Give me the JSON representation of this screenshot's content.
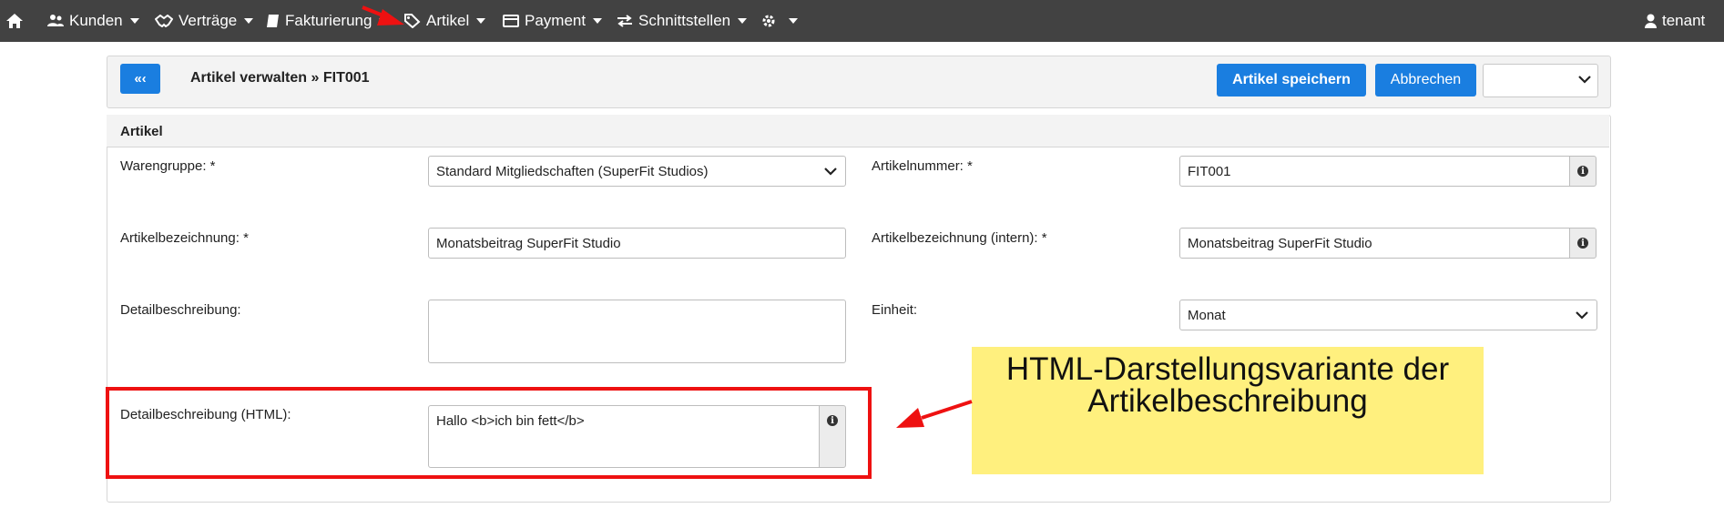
{
  "nav": {
    "items": [
      {
        "label": "Kunden"
      },
      {
        "label": "Verträge"
      },
      {
        "label": "Fakturierung"
      },
      {
        "label": "Artikel"
      },
      {
        "label": "Payment"
      },
      {
        "label": "Schnittstellen"
      }
    ],
    "user": "tenant"
  },
  "header": {
    "back_label": "«‹",
    "title": "Artikel verwalten » FIT001",
    "save_label": "Artikel speichern",
    "cancel_label": "Abbrechen",
    "select_value": ""
  },
  "panel": {
    "title": "Artikel",
    "fields": {
      "warengruppe": {
        "label": "Warengruppe: *",
        "value": "Standard Mitgliedschaften (SuperFit Studios)"
      },
      "artikelnummer": {
        "label": "Artikelnummer: *",
        "value": "FIT001"
      },
      "artikelbezeichnung": {
        "label": "Artikelbezeichnung: *",
        "value": "Monatsbeitrag SuperFit Studio"
      },
      "artikelbezeichnung_intern": {
        "label": "Artikelbezeichnung (intern): *",
        "value": "Monatsbeitrag SuperFit Studio"
      },
      "detailbeschreibung": {
        "label": "Detailbeschreibung:",
        "value": ""
      },
      "einheit": {
        "label": "Einheit:",
        "value": "Monat"
      },
      "detailbeschreibung_html": {
        "label": "Detailbeschreibung (HTML):",
        "value": "Hallo <b>ich bin fett</b>"
      }
    }
  },
  "annotation": {
    "note_line1": "HTML-Darstellungsvariante der",
    "note_line2": "Artikelbeschreibung",
    "color_red": "#ee1111",
    "color_note": "#fff07e"
  },
  "colors": {
    "navbar": "#424242",
    "primary": "#1a7ee0"
  }
}
